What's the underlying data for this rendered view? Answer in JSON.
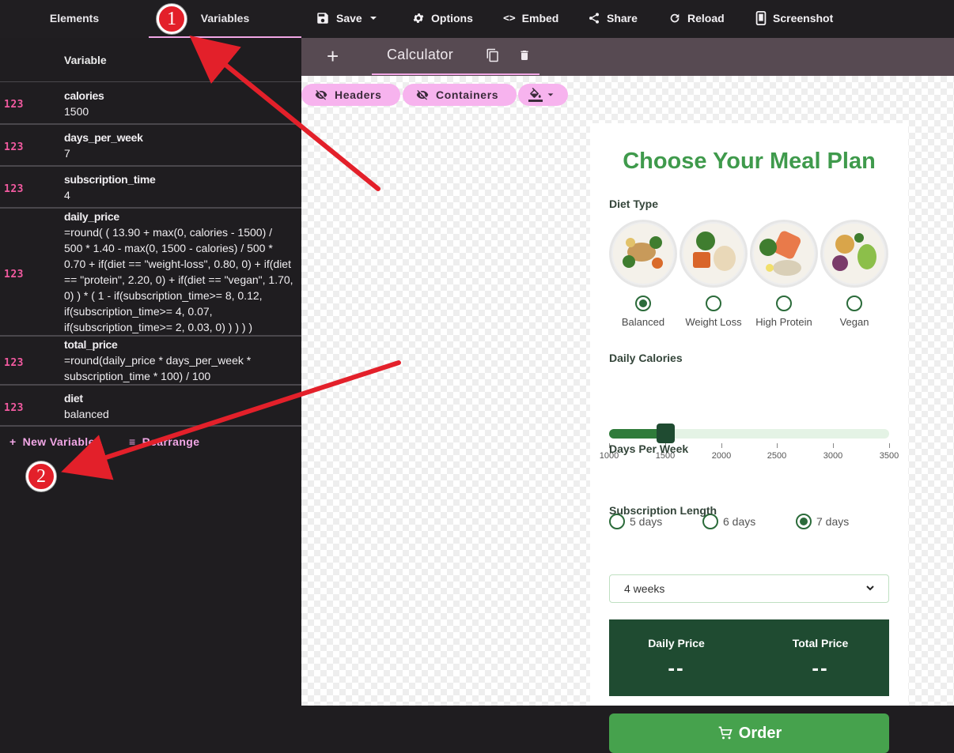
{
  "topbar": {
    "tabs": [
      "Elements",
      "Variables"
    ],
    "tools": {
      "save": "Save",
      "options": "Options",
      "embed": "Embed",
      "share": "Share",
      "reload": "Reload",
      "screenshot": "Screenshot"
    }
  },
  "variables_panel": {
    "header": "Variable",
    "type_label": "123",
    "items": [
      {
        "name": "calories",
        "value": "1500"
      },
      {
        "name": "days_per_week",
        "value": "7"
      },
      {
        "name": "subscription_time",
        "value": "4"
      },
      {
        "name": "daily_price",
        "value": "=round( ( 13.90 + max(0, calories - 1500) /\n500 * 1.40 - max(0, 1500 - calories) / 500 *\n0.70 + if(diet == \"weight-loss\", 0.80, 0) + if(diet\n== \"protein\", 2.20, 0) + if(diet == \"vegan\", 1.70,\n0) ) * ( 1 - if(subscription_time>= 8, 0.12,\nif(subscription_time>= 4, 0.07,\nif(subscription_time>= 2, 0.03, 0) ) ) ) )"
      },
      {
        "name": "total_price",
        "value": "=round(daily_price * days_per_week *\nsubscription_time * 100) / 100"
      },
      {
        "name": "diet",
        "value": "balanced"
      }
    ],
    "actions": {
      "new_variable": "New Variable",
      "rearrange": "Rearrange"
    }
  },
  "canvas_tabs": {
    "plus": "+",
    "active_tab": "Calculator"
  },
  "canvas_toolbar": {
    "headers": "Headers",
    "containers": "Containers"
  },
  "calculator": {
    "title": "Choose Your Meal Plan",
    "diet_label": "Diet Type",
    "diets": [
      {
        "label": "Balanced",
        "selected": true
      },
      {
        "label": "Weight Loss",
        "selected": false
      },
      {
        "label": "High Protein",
        "selected": false
      },
      {
        "label": "Vegan",
        "selected": false
      }
    ],
    "calories_label": "Daily Calories",
    "slider": {
      "min": 1000,
      "max": 3500,
      "value": 1500,
      "ticks": [
        "1000",
        "1500",
        "2000",
        "2500",
        "3000",
        "3500"
      ]
    },
    "days_label": "Days Per Week",
    "days": [
      {
        "label": "5 days",
        "selected": false
      },
      {
        "label": "6 days",
        "selected": false
      },
      {
        "label": "7 days",
        "selected": true
      }
    ],
    "subscription_label": "Subscription Length",
    "subscription_value": "4 weeks",
    "daily_price_label": "Daily Price",
    "daily_price_value": "--",
    "total_price_label": "Total Price",
    "total_price_value": "--",
    "order_label": "Order"
  },
  "annotations": {
    "badge1": "1",
    "badge2": "2"
  },
  "colors": {
    "accent_pink": "#f2a7e6",
    "type_pink": "#f25aa0",
    "green": "#3f9a4c",
    "dark_green": "#1f4b31",
    "arrow_red": "#e3202a"
  }
}
